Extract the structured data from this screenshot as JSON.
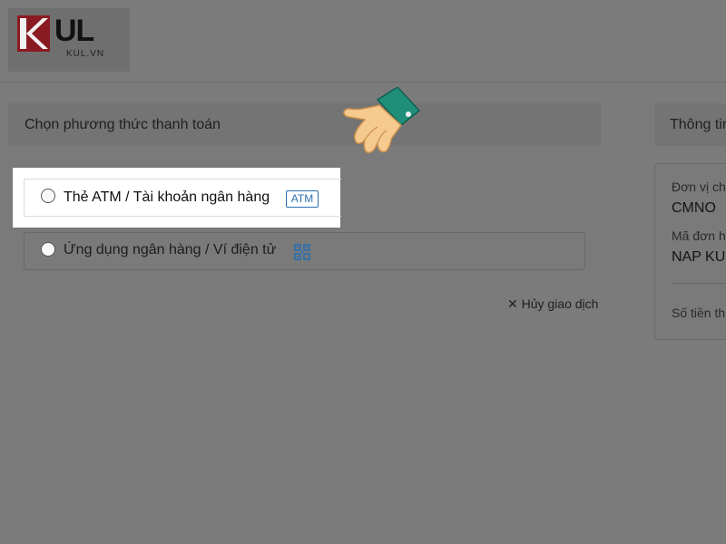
{
  "header": {
    "logo_main": "UL",
    "logo_sub": "KUL.VN"
  },
  "payment": {
    "title": "Chọn phương thức thanh toán",
    "options": [
      {
        "label": "Thẻ ATM / Tài khoản ngân hàng",
        "badge": "ATM",
        "icon": "atm-badge"
      },
      {
        "label": "Ứng dụng ngân hàng / Ví điện tử",
        "icon": "qr-code-icon"
      }
    ],
    "cancel_label": "Hủy giao dịch"
  },
  "info": {
    "title": "Thông tin",
    "supplier_label": "Đơn vị ch",
    "supplier_value": "CMNO",
    "order_label": "Mã đơn h",
    "order_value": "NAP KU",
    "amount_label": "Số tiền th"
  },
  "colors": {
    "accent_blue": "#2a6fb0",
    "logo_red": "#c8102e",
    "hand_cuff": "#1f8f7a",
    "hand_skin": "#f6c98f"
  }
}
